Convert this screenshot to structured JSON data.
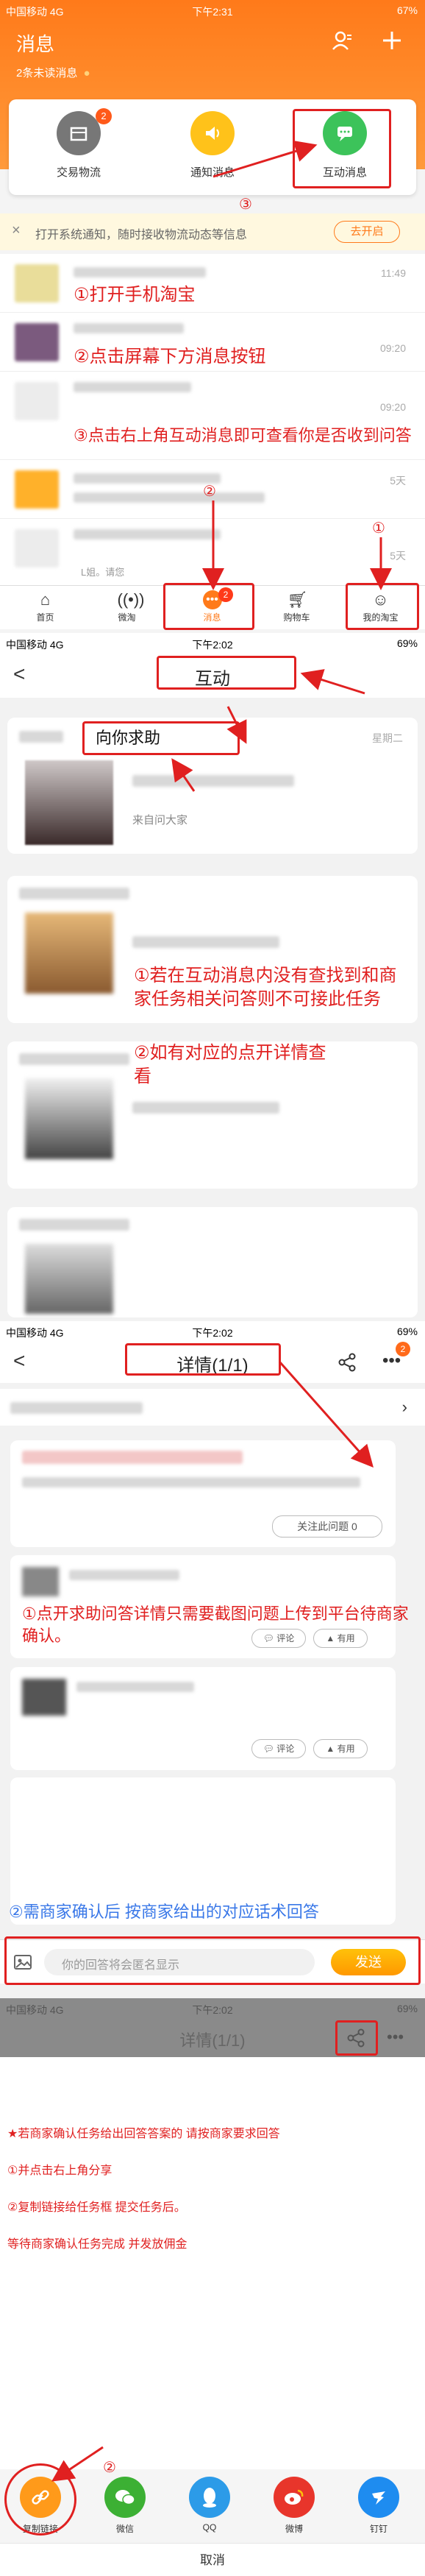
{
  "screen1": {
    "status": {
      "carrier": "中国移动 4G",
      "time": "下午2:31",
      "battery": "67%"
    },
    "header": {
      "title": "消息",
      "unread": "2条未读消息",
      "unread_dot": "●"
    },
    "categories": [
      {
        "label": "交易物流",
        "badge": "2"
      },
      {
        "label": "通知消息"
      },
      {
        "label": "互动消息"
      }
    ],
    "circle3": "③",
    "notice": {
      "close": "×",
      "text": "打开系统通知，随时接收物流动态等信息",
      "button": "去开启"
    },
    "rows": [
      {
        "time": "11:49",
        "note": "①打开手机淘宝"
      },
      {
        "time": "09:20",
        "note": "②点击屏幕下方消息按钮"
      },
      {
        "time": "09:20",
        "note": "③点击右上角互动消息即可查看你是否收到问答"
      },
      {
        "time": "5天"
      },
      {
        "time": "5天",
        "snippet": "L姐。请您"
      }
    ],
    "tabs": [
      {
        "label": "首页"
      },
      {
        "label": "微淘"
      },
      {
        "label": "消息",
        "badge": "2"
      },
      {
        "label": "购物车"
      },
      {
        "label": "我的淘宝"
      }
    ],
    "circle1": "①",
    "circle2": "②"
  },
  "screen2": {
    "status": {
      "carrier": "中国移动 4G",
      "time": "下午2:02",
      "battery": "69%"
    },
    "back": "<",
    "title": "互动",
    "card_title": "向你求助",
    "card_day": "星期二",
    "card_from": "来自问大家",
    "note1": "①若在互动消息内没有查找到和商家任务相关问答则不可接此任务",
    "note2": "②如有对应的点开详情查看"
  },
  "screen3": {
    "status": {
      "carrier": "中国移动 4G",
      "time": "下午2:02",
      "battery": "69%"
    },
    "back": "<",
    "title": "详情(1/1)",
    "more_badge": "2",
    "follow": "关注此问题 0",
    "note1": "①点开求助问答详情只需要截图问题上传到平台待商家确认。",
    "comment": "评论",
    "useful": "有用",
    "note2": "②需商家确认后 按商家给出的对应话术回答",
    "input_placeholder": "你的回答将会匿名显示",
    "send": "发送"
  },
  "screen4": {
    "status": {
      "carrier": "中国移动 4G",
      "time": "下午2:02",
      "battery": "69%"
    },
    "title": "详情(1/1)",
    "instructions": [
      "★若商家确认任务给出回答答案的 请按商家要求回答",
      "①并点击右上角分享",
      "②复制链接给任务框 提交任务后。",
      "等待商家确认任务完成 并发放佣金"
    ],
    "share_items": [
      {
        "label": "复制链接"
      },
      {
        "label": "微信"
      },
      {
        "label": "QQ"
      },
      {
        "label": "微博"
      },
      {
        "label": "钉钉"
      }
    ],
    "circle2": "②",
    "cancel": "取消"
  }
}
